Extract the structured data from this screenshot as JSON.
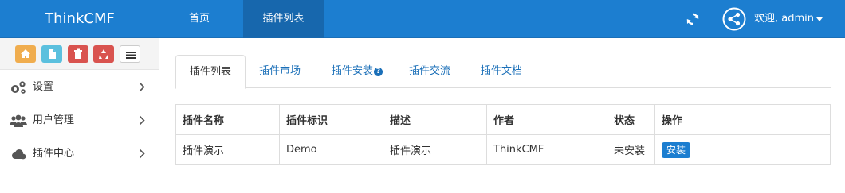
{
  "navbar": {
    "brand": "ThinkCMF",
    "home": "首页",
    "plugins": "插件列表",
    "user": "欢迎, admin"
  },
  "sidebar": {
    "items": [
      {
        "label": "设置",
        "icon": "gears-icon"
      },
      {
        "label": "用户管理",
        "icon": "users-icon"
      },
      {
        "label": "插件中心",
        "icon": "cloud-icon"
      }
    ]
  },
  "tabs": [
    "插件列表",
    "插件市场",
    "插件安装",
    "插件交流",
    "插件文档"
  ],
  "table": {
    "headers": [
      "插件名称",
      "插件标识",
      "描述",
      "作者",
      "状态",
      "操作"
    ],
    "rows": [
      {
        "name": "插件演示",
        "id": "Demo",
        "desc": "插件演示",
        "author": "ThinkCMF",
        "status": "未安装",
        "action": "安装"
      }
    ]
  },
  "colors": {
    "primary": "#1c7ed0",
    "warning": "#f0ad4e",
    "info": "#5bc0de",
    "danger": "#d9534f"
  }
}
